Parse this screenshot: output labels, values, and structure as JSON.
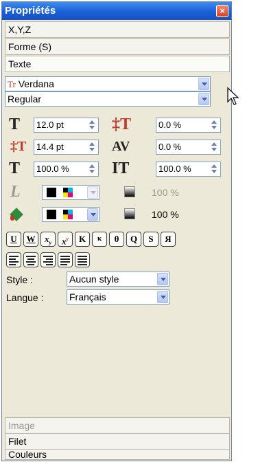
{
  "panel": {
    "title": "Propriétés",
    "close_label": "×"
  },
  "sections_top": [
    {
      "label": "X,Y,Z"
    },
    {
      "label": "Forme (S)"
    },
    {
      "label": "Texte"
    }
  ],
  "font": {
    "family": "Verdana",
    "style": "Regular",
    "font_icon": "Tr"
  },
  "spinners": {
    "size": "12.0 pt",
    "spacing": "0.0 %",
    "leading": "14.4 pt",
    "kerning": "0.0 %",
    "hscale": "100.0 %",
    "vscale": "100.0 %"
  },
  "stroke_row": {
    "opacity": "100 %"
  },
  "fill_row": {
    "opacity": "100 %"
  },
  "style_buttons": [
    "U",
    "W",
    "x",
    "x",
    "K",
    "κ",
    "θ",
    "Q",
    "S",
    "Я"
  ],
  "labels": {
    "style": "Style :",
    "language": "Langue :"
  },
  "dropdowns": {
    "style_value": "Aucun style",
    "language_value": "Français"
  },
  "sections_bottom": [
    {
      "label": "Image"
    },
    {
      "label": "Filet"
    },
    {
      "label": "Couleurs"
    }
  ],
  "colors": {
    "titlebar": "#1a5fd6",
    "fill_icon": "#2e8b3a",
    "text_icon": "#c0392b"
  }
}
